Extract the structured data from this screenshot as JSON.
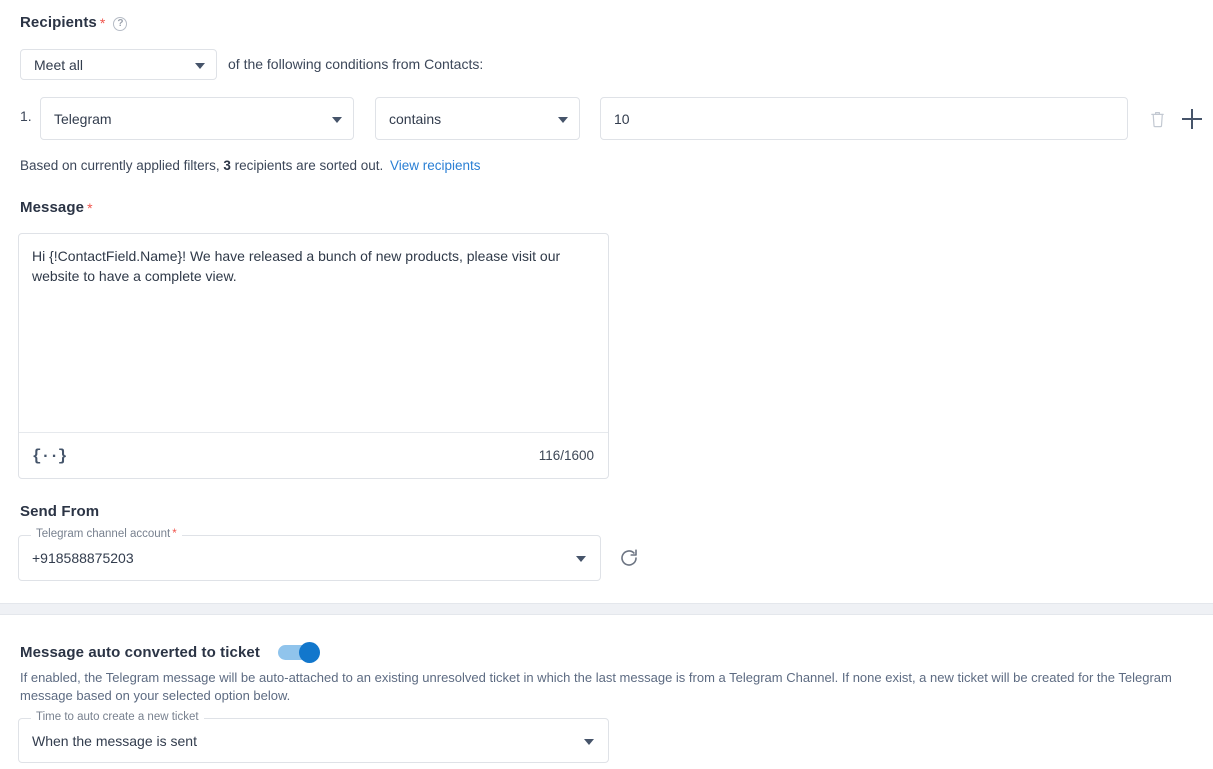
{
  "recipients": {
    "title": "Recipients",
    "required_mark": "*",
    "help_icon": "question-mark-icon",
    "match_select_value": "Meet all",
    "conditions_text": "of the following conditions from Contacts:",
    "condition_index": "1.",
    "condition_field": "Telegram",
    "condition_operator": "contains",
    "condition_value": "10",
    "delete_icon": "trash-icon",
    "add_icon": "plus-icon",
    "summary_prefix": "Based on currently applied filters,",
    "summary_count": "3",
    "summary_suffix": "recipients are sorted out.",
    "view_link": "View recipients"
  },
  "message": {
    "title": "Message",
    "required_mark": "*",
    "body": "Hi {!ContactField.Name}! We have released a bunch of new products, please visit our website to have a complete view.",
    "merge_field_icon": "{··}",
    "char_counter": "116/1600"
  },
  "send_from": {
    "title": "Send From",
    "account_label": "Telegram channel account",
    "account_required_mark": "*",
    "account_value": "+918588875203",
    "refresh_icon": "refresh-icon"
  },
  "ticket": {
    "title": "Message auto converted to ticket",
    "toggle_state": "on",
    "description": "If enabled, the Telegram message will be auto-attached to an existing unresolved ticket in which the last message is from a Telegram Channel. If none exist, a new ticket will be created for the Telegram message based on your selected option below.",
    "time_label": "Time to auto create a new ticket",
    "time_value": "When the message is sent"
  },
  "colors": {
    "accent_blue": "#2a7fd4",
    "toggle_on": "#1277cc",
    "toggle_track": "#90c4ec",
    "required_red": "#f0554d",
    "text_primary": "#2b3445",
    "border": "#dfe2e7",
    "divider_band": "#eff1f5"
  }
}
